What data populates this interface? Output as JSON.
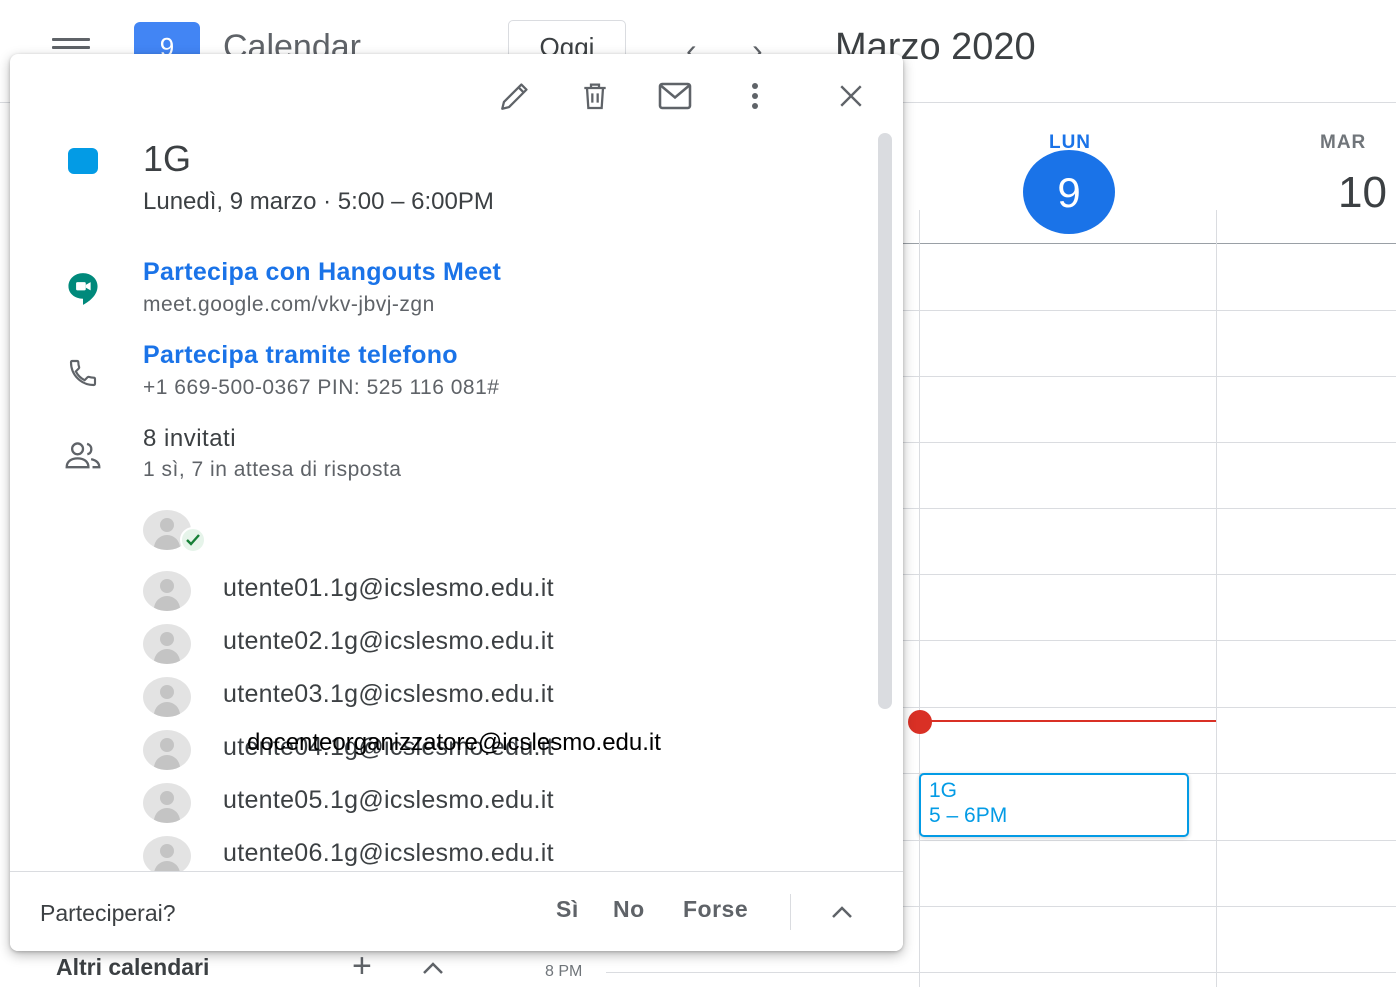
{
  "topbar": {
    "app_name": "Calendar",
    "logo_text": "9",
    "today_label": "Oggi",
    "prev_label": "‹",
    "next_label": "›",
    "month_title": "Marzo 2020"
  },
  "grid": {
    "days": [
      {
        "label": "LUN",
        "number": "9"
      },
      {
        "label": "MAR",
        "number": "10"
      }
    ],
    "event": {
      "title": "1G",
      "time": "5 – 6PM"
    }
  },
  "sidebar": {
    "other_calendars": "Altri calendari",
    "add": "+",
    "collapse": "^",
    "time_label": "8 PM"
  },
  "popup": {
    "title": "1G",
    "when": "Lunedì, 9 marzo  ·  5:00 – 6:00PM",
    "meet": {
      "title": "Partecipa con Hangouts Meet",
      "url": "meet.google.com/vkv-jbvj-zgn"
    },
    "phone": {
      "title": "Partecipa tramite telefono",
      "details": "+1 669-500-0367 PIN: 525 116 081#"
    },
    "guests": {
      "count": "8 invitati",
      "status": "1 sì, 7 in attesa di risposta",
      "list": [
        "utente01.1g@icslesmo.edu.it",
        "utente02.1g@icslesmo.edu.it",
        "utente03.1g@icslesmo.edu.it",
        "utente04.1g@icslesmo.edu.it",
        "utente05.1g@icslesmo.edu.it",
        "utente06.1g@icslesmo.edu.it"
      ]
    },
    "overlay_text": "docenteorganizzatore@icslesmo.edu.it",
    "footer": {
      "question": "Parteciperai?",
      "yes": "Sì",
      "no": "No",
      "maybe": "Forse"
    }
  },
  "colors": {
    "accent": "#1a73e8",
    "event": "#039be5",
    "now_line": "#d93025",
    "meet_green": "#00897b"
  }
}
